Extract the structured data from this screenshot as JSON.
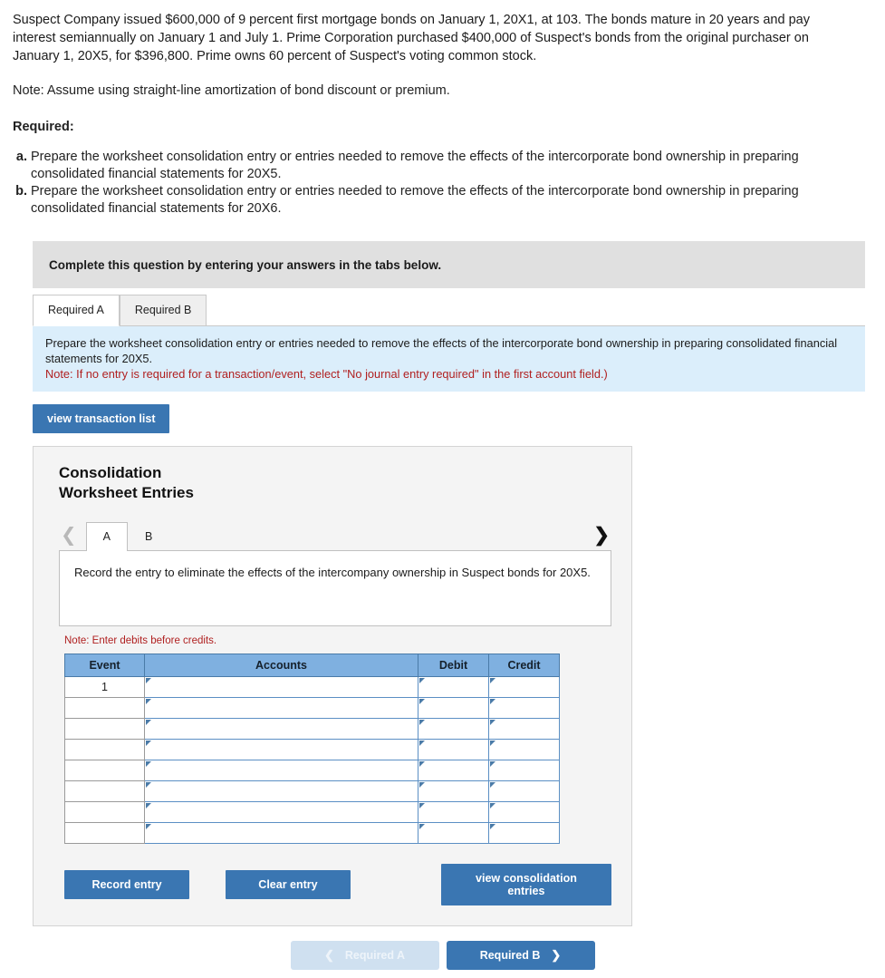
{
  "problem": {
    "paragraph": "Suspect Company issued $600,000 of 9 percent first mortgage bonds on January 1, 20X1, at 103. The bonds mature in 20 years and pay interest semiannually on January 1 and July 1. Prime Corporation purchased $400,000 of Suspect's bonds from the original purchaser on January 1, 20X5, for $396,800. Prime owns 60 percent of Suspect's voting common stock.",
    "note": "Note: Assume using straight-line amortization of bond discount or premium.",
    "required_heading": "Required:",
    "requirements": [
      {
        "letter": "a.",
        "text": "Prepare the worksheet consolidation entry or entries needed to remove the effects of the intercorporate bond ownership in preparing consolidated financial statements for 20X5."
      },
      {
        "letter": "b.",
        "text": "Prepare the worksheet consolidation entry or entries needed to remove the effects of the intercorporate bond ownership in preparing consolidated financial statements for 20X6."
      }
    ]
  },
  "banner": {
    "text": "Complete this question by entering your answers in the tabs below."
  },
  "tabs": [
    {
      "label": "Required A",
      "active": true
    },
    {
      "label": "Required B",
      "active": false
    }
  ],
  "info": {
    "line1": "Prepare the worksheet consolidation entry or entries needed to remove the effects of the intercorporate bond ownership in preparing consolidated financial statements for 20X5.",
    "line2": "Note: If no entry is required for a transaction/event, select \"No journal entry required\" in the first account field.)"
  },
  "view_transaction_button": "view transaction list",
  "panel": {
    "title_line1": "Consolidation",
    "title_line2": "Worksheet Entries",
    "nav_prev_icon": "chevron-left-icon",
    "nav_next_icon": "chevron-right-icon",
    "subtabs": [
      {
        "label": "A",
        "active": true
      },
      {
        "label": "B",
        "active": false
      }
    ],
    "description": "Record the entry to eliminate the effects of the intercompany ownership in Suspect bonds for 20X5.",
    "note_red": "Note: Enter debits before credits.",
    "table": {
      "headers": [
        "Event",
        "Accounts",
        "Debit",
        "Credit"
      ],
      "rows": [
        {
          "event": "1",
          "accounts": "",
          "debit": "",
          "credit": ""
        },
        {
          "event": "",
          "accounts": "",
          "debit": "",
          "credit": ""
        },
        {
          "event": "",
          "accounts": "",
          "debit": "",
          "credit": ""
        },
        {
          "event": "",
          "accounts": "",
          "debit": "",
          "credit": ""
        },
        {
          "event": "",
          "accounts": "",
          "debit": "",
          "credit": ""
        },
        {
          "event": "",
          "accounts": "",
          "debit": "",
          "credit": ""
        },
        {
          "event": "",
          "accounts": "",
          "debit": "",
          "credit": ""
        },
        {
          "event": "",
          "accounts": "",
          "debit": "",
          "credit": ""
        }
      ]
    },
    "actions": {
      "record": "Record entry",
      "clear": "Clear entry",
      "view": "view consolidation entries"
    }
  },
  "footer": {
    "prev_label": "Required A",
    "next_label": "Required B",
    "prev_icon": "chevron-left-icon",
    "next_icon": "chevron-right-icon"
  },
  "colors": {
    "accent_blue": "#3a76b2",
    "table_header_blue": "#7fb0e0",
    "info_blue": "#dbeefb",
    "banner_gray": "#e0e0e0",
    "note_red": "#b02020",
    "panel_gray": "#f4f4f4"
  }
}
